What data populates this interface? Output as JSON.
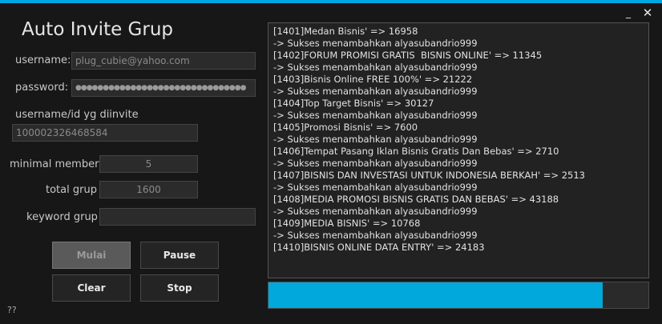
{
  "window": {
    "title": "Auto Invite Grup",
    "minimize_glyph": "_",
    "close_glyph": "✕",
    "accent_color": "#00a8e0"
  },
  "form": {
    "username_label": "username:",
    "username_value": "plug_cubie@yahoo.com",
    "password_label": "password:",
    "password_value": "●●●●●●●●●●●●●●●●●●●●●●●●●●●●●●●",
    "target_label": "username/id yg diinvite",
    "target_value": "100002326468584",
    "min_member_label": "minimal member",
    "min_member_value": "5",
    "total_group_label": "total grup",
    "total_group_value": "1600",
    "keyword_label": "keyword grup",
    "keyword_value": ""
  },
  "buttons": {
    "start": "Mulai",
    "pause": "Pause",
    "clear": "Clear",
    "stop": "Stop"
  },
  "log": [
    "[1401]Medan Bisnis' => 16958",
    "-> Sukses menambahkan alyasubandrio999",
    "[1402]FORUM PROMISI GRATIS  BISNIS ONLINE' => 11345",
    "-> Sukses menambahkan alyasubandrio999",
    "[1403]Bisnis Online FREE 100%' => 21222",
    "-> Sukses menambahkan alyasubandrio999",
    "[1404]Top Target Bisnis' => 30127",
    "-> Sukses menambahkan alyasubandrio999",
    "[1405]Promosi Bisnis' => 7600",
    "-> Sukses menambahkan alyasubandrio999",
    "[1406]Tempat Pasang Iklan Bisnis Gratis Dan Bebas' => 2710",
    "-> Sukses menambahkan alyasubandrio999",
    "[1407]BISNIS DAN INVESTASI UNTUK INDONESIA BERKAH' => 2513",
    "-> Sukses menambahkan alyasubandrio999",
    "[1408]MEDIA PROMOSI BISNIS GRATIS DAN BEBAS' => 43188",
    "-> Sukses menambahkan alyasubandrio999",
    "[1409]MEDIA BISNIS' => 10768",
    "-> Sukses menambahkan alyasubandrio999",
    "[1410]BISNIS ONLINE DATA ENTRY' => 24183"
  ],
  "progress": {
    "fraction": 0.88,
    "color": "#00a8dc"
  },
  "help_text": "??"
}
